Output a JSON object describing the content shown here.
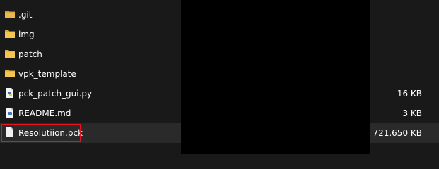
{
  "files": [
    {
      "name": ".git",
      "type": "folder",
      "icon": "folder-icon",
      "size": ""
    },
    {
      "name": "img",
      "type": "folder",
      "icon": "folder-icon",
      "size": ""
    },
    {
      "name": "patch",
      "type": "folder",
      "icon": "folder-icon",
      "size": ""
    },
    {
      "name": "vpk_template",
      "type": "folder",
      "icon": "folder-icon",
      "size": ""
    },
    {
      "name": "pck_patch_gui.py",
      "type": "file",
      "icon": "python-file-icon",
      "size": "16 KB"
    },
    {
      "name": "README.md",
      "type": "file",
      "icon": "markdown-file-icon",
      "size": "3 KB"
    },
    {
      "name": "Resolutiion.pck",
      "type": "file",
      "icon": "file-icon",
      "size": "721.650 KB",
      "selected": true
    }
  ],
  "colors": {
    "background": "#191919",
    "selected_row": "#2a2a2a",
    "highlight_border": "#e81123",
    "folder": "#e9b84c",
    "redaction": "#000000"
  }
}
